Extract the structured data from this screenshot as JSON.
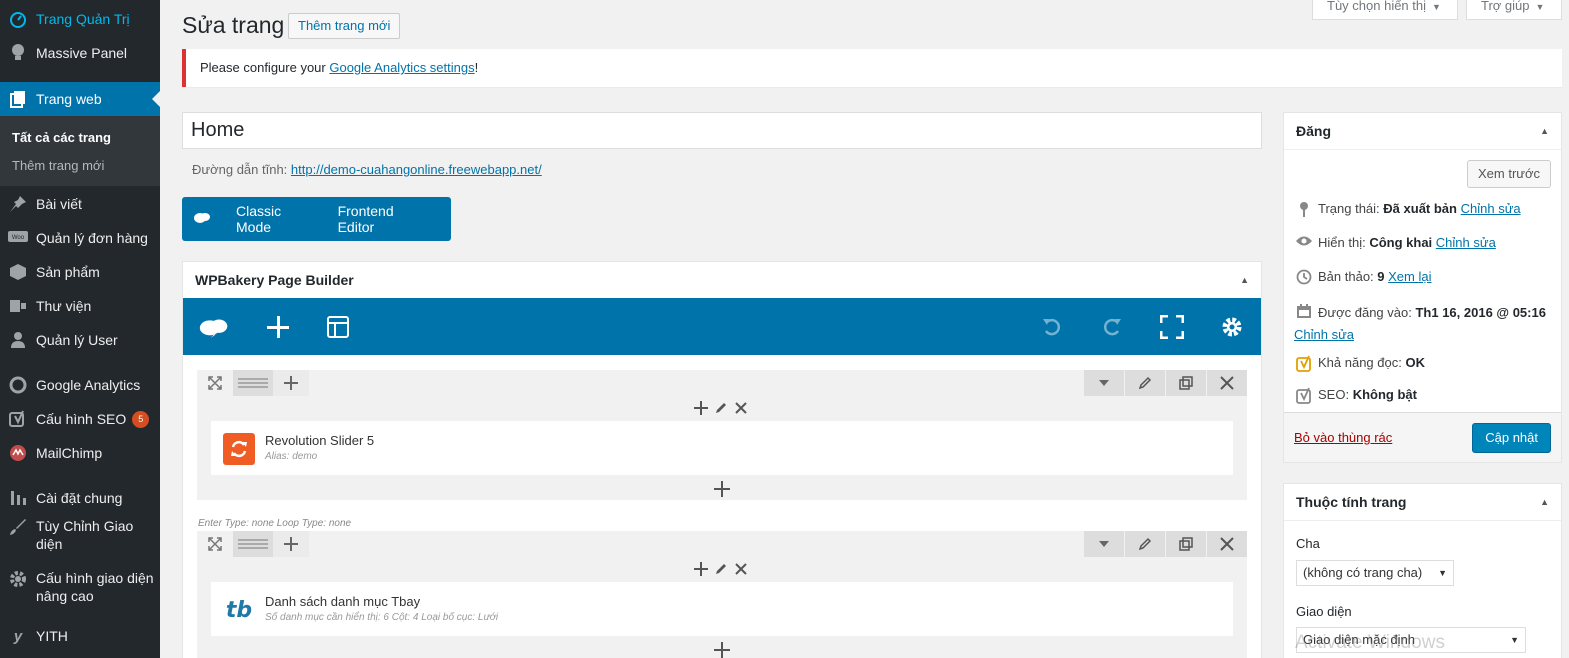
{
  "sidebar": {
    "items": [
      {
        "label": "Trang Quản Trị",
        "icon": "dashboard-icon"
      },
      {
        "label": "Massive Panel",
        "icon": "lightbulb-icon"
      },
      {
        "label": "Trang web",
        "icon": "pages-icon"
      },
      {
        "label": "Bài viết",
        "icon": "pin-icon"
      },
      {
        "label": "Quản lý đơn hàng",
        "icon": "woo-icon"
      },
      {
        "label": "Sản phẩm",
        "icon": "box-icon"
      },
      {
        "label": "Thư viện",
        "icon": "media-icon"
      },
      {
        "label": "Quản lý User",
        "icon": "user-icon"
      },
      {
        "label": "Google Analytics",
        "icon": "analytics-icon"
      },
      {
        "label": "Cấu hình SEO",
        "icon": "yoast-icon",
        "badge": "5"
      },
      {
        "label": "MailChimp",
        "icon": "mailchimp-icon"
      },
      {
        "label": "Cài đặt chung",
        "icon": "settings-icon"
      },
      {
        "label": "Tùy Chỉnh Giao diện",
        "icon": "brush-icon"
      },
      {
        "label": "Cấu hình giao diện nâng cao",
        "icon": "gear-icon"
      },
      {
        "label": "YITH",
        "icon": "yith-icon"
      }
    ],
    "submenu": [
      "Tất cả các trang",
      "Thêm trang mới"
    ]
  },
  "header": {
    "title": "Sửa trang",
    "add_new": "Thêm trang mới",
    "screen_options": "Tùy chọn hiển thị",
    "help": "Trợ giúp"
  },
  "notice": {
    "prefix": "Please configure your ",
    "link": "Google Analytics settings",
    "suffix": "!"
  },
  "editor": {
    "title_value": "Home",
    "permalink_label": "Đường dẫn tĩnh:",
    "permalink_url": "http://demo-cuahangonline.freewebapp.net/",
    "classic_mode": "Classic Mode",
    "frontend_editor": "Frontend Editor"
  },
  "wpbakery": {
    "title": "WPBakery Page Builder",
    "rows": [
      {
        "element_name": "Revolution Slider 5",
        "element_desc": "Alias: demo",
        "icon": "revslider-icon"
      },
      {
        "note": "Enter Type: none  Loop Type: none",
        "element_name": "Danh sách danh mục Tbay",
        "element_desc": "Số danh mục cần hiển thị: 6  Cột: 4  Loại bố cục: Lưới",
        "icon": "tbay-icon",
        "icon_text": "tb"
      }
    ]
  },
  "publish": {
    "title": "Đăng",
    "preview": "Xem trước",
    "status_label": "Trạng thái:",
    "status_value": "Đã xuất bản",
    "visibility_label": "Hiển thị:",
    "visibility_value": "Công khai",
    "revisions_label": "Bản thảo:",
    "revisions_value": "9",
    "revisions_link": "Xem lại",
    "published_label": "Được đăng vào:",
    "published_value": "Th1 16, 2016 @ 05:16",
    "readability_label": "Khả năng đọc:",
    "readability_value": "OK",
    "seo_label": "SEO:",
    "seo_value": "Không bật",
    "edit_link": "Chỉnh sửa",
    "trash": "Bỏ vào thùng rác",
    "update": "Cập nhật"
  },
  "page_attributes": {
    "title": "Thuộc tính trang",
    "parent_label": "Cha",
    "parent_value": "(không có trang cha)",
    "template_label": "Giao diện",
    "template_value": "Giao diện mặc định"
  },
  "watermark": "Activate Windows",
  "colors": {
    "accent": "#0073aa",
    "sidebar": "#23282d",
    "notice_error": "#dc3232",
    "badge": "#d54e21"
  }
}
